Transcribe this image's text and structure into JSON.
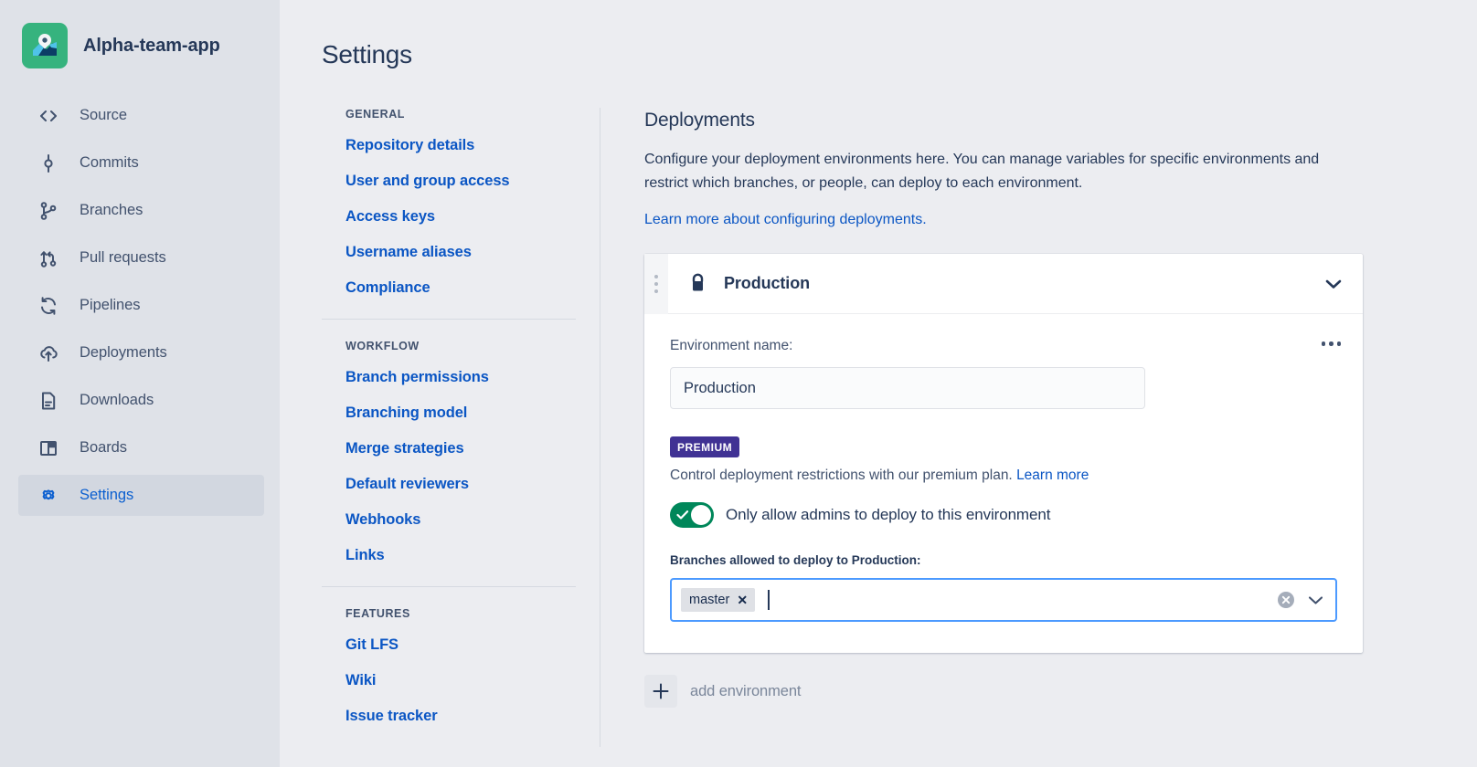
{
  "sidebar": {
    "repo": {
      "name": "Alpha-team-app",
      "avatar_icon": "map-pin-avatar",
      "avatar_color": "#36B37E"
    },
    "items": [
      {
        "label": "Source",
        "icon": "source-code-icon",
        "active": false
      },
      {
        "label": "Commits",
        "icon": "commits-icon",
        "active": false
      },
      {
        "label": "Branches",
        "icon": "branches-icon",
        "active": false
      },
      {
        "label": "Pull requests",
        "icon": "pull-request-icon",
        "active": false
      },
      {
        "label": "Pipelines",
        "icon": "pipelines-icon",
        "active": false
      },
      {
        "label": "Deployments",
        "icon": "deployments-icon",
        "active": false
      },
      {
        "label": "Downloads",
        "icon": "downloads-icon",
        "active": false
      },
      {
        "label": "Boards",
        "icon": "boards-icon",
        "active": false
      },
      {
        "label": "Settings",
        "icon": "gear-icon",
        "active": true
      }
    ]
  },
  "page": {
    "title": "Settings"
  },
  "settings_nav": {
    "groups": [
      {
        "title": "GENERAL",
        "links": [
          "Repository details",
          "User and group access",
          "Access keys",
          "Username aliases",
          "Compliance"
        ]
      },
      {
        "title": "WORKFLOW",
        "links": [
          "Branch permissions",
          "Branching model",
          "Merge strategies",
          "Default reviewers",
          "Webhooks",
          "Links"
        ]
      },
      {
        "title": "FEATURES",
        "links": [
          "Git LFS",
          "Wiki",
          "Issue tracker"
        ]
      }
    ]
  },
  "deployments": {
    "section_title": "Deployments",
    "description": "Configure your deployment environments here. You can manage variables for specific environments and restrict which branches, or people, can deploy to each environment.",
    "learn_more_link": "Learn more about configuring deployments.",
    "environment": {
      "header_title": "Production",
      "lock_icon": "lock-icon",
      "drag_handle_icon": "drag-handle-icon",
      "collapse_icon": "chevron-down-icon",
      "more_icon": "more-horizontal-icon",
      "name_label": "Environment name:",
      "name_value": "Production",
      "name_placeholder": "Environment name",
      "premium_badge": "PREMIUM",
      "premium_color": "#403294",
      "premium_desc": "Control deployment restrictions with our premium plan.",
      "premium_link": "Learn more",
      "toggle": {
        "label": "Only allow admins to deploy to this environment",
        "state": "on",
        "color": "#00875A"
      },
      "branches_label": "Branches allowed to deploy to Production:",
      "branches_tags": [
        "master"
      ],
      "branches_placeholder": "",
      "clear_icon": "clear-circle-icon",
      "dropdown_icon": "chevron-down-icon"
    },
    "add_environment": {
      "label": "add environment",
      "icon": "plus-icon"
    }
  }
}
